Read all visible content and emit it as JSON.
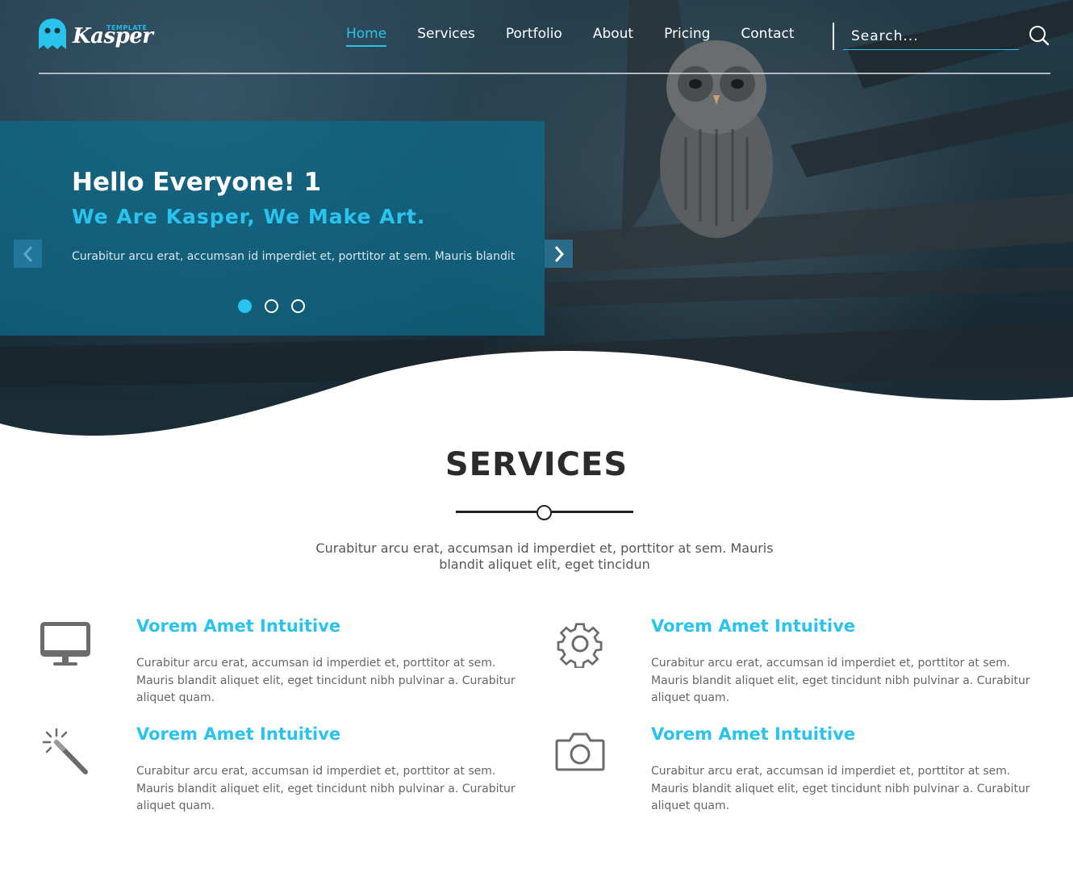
{
  "header": {
    "logo": {
      "word": "Kasper",
      "sub": "TEMPLATE"
    },
    "nav": [
      {
        "label": "Home"
      },
      {
        "label": "Services"
      },
      {
        "label": "Portfolio"
      },
      {
        "label": "About"
      },
      {
        "label": "Pricing"
      },
      {
        "label": "Contact"
      }
    ],
    "search": {
      "placeholder": "Search..."
    }
  },
  "slider": {
    "title": "Hello Everyone! 1",
    "subtitle": "We Are Kasper, We Make Art.",
    "text": "Curabitur arcu erat, accumsan id imperdiet et, porttitor at sem. Mauris blandit",
    "slide_count": 3,
    "active_slide": 1
  },
  "services": {
    "title": "SERVICES",
    "intro": "Curabitur arcu erat, accumsan id imperdiet et, porttitor at sem. Mauris blandit aliquet elit, eget tincidun",
    "items": [
      {
        "icon": "desktop-icon",
        "heading": "Vorem Amet Intuitive",
        "text": "Curabitur arcu erat, accumsan id imperdiet et, porttitor at sem. Mauris blandit aliquet elit, eget tincidunt nibh pulvinar a. Curabitur aliquet quam."
      },
      {
        "icon": "gear-icon",
        "heading": "Vorem Amet Intuitive",
        "text": "Curabitur arcu erat, accumsan id imperdiet et, porttitor at sem. Mauris blandit aliquet elit, eget tincidunt nibh pulvinar a. Curabitur aliquet quam."
      },
      {
        "icon": "magic-wand-icon",
        "heading": "Vorem Amet Intuitive",
        "text": "Curabitur arcu erat, accumsan id imperdiet et, porttitor at sem. Mauris blandit aliquet elit, eget tincidunt nibh pulvinar a. Curabitur aliquet quam."
      },
      {
        "icon": "camera-icon",
        "heading": "Vorem Amet Intuitive",
        "text": "Curabitur arcu erat, accumsan id imperdiet et, porttitor at sem. Mauris blandit aliquet elit, eget tincidunt nibh pulvinar a. Curabitur aliquet quam."
      }
    ]
  },
  "colors": {
    "accent": "#29c3ee",
    "panel": "#0c6c8c",
    "text": "#666666"
  }
}
